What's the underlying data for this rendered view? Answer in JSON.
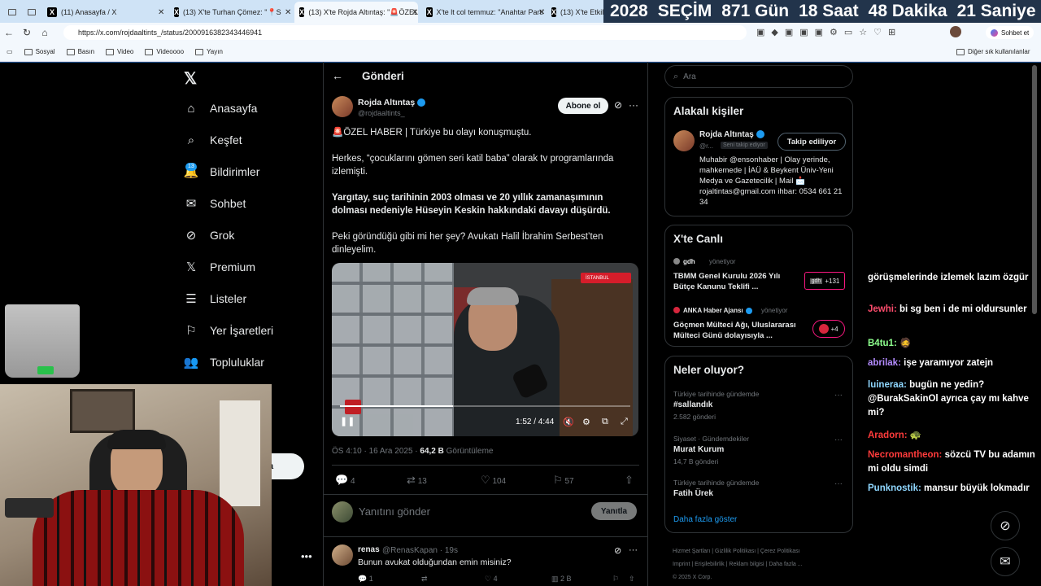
{
  "tabs": [
    {
      "label": "(11) Anasayfa / X"
    },
    {
      "label": "(13) X'te Turhan Çömez: \"📍Sağlı"
    },
    {
      "label": "(13) X'te Rojda Altıntaş: \"🚨ÖZEL"
    },
    {
      "label": "X'te lt col temmuz: \"Anahtar Parti"
    },
    {
      "label": "(13) X'te Etkili"
    }
  ],
  "countdown": {
    "year": "2028",
    "label": "SEÇİM",
    "days": "871 Gün",
    "hours": "18 Saat",
    "minutes": "48 Dakika",
    "seconds": "21 Saniye"
  },
  "address": {
    "url": "https://x.com/rojdaaltints_/status/2000916382343446941",
    "chat_button": "Sohbet et"
  },
  "bookmarks": {
    "items": [
      "Sosyal",
      "Basın",
      "Video",
      "Videoooo",
      "Yayın"
    ],
    "other": "Diğer sık kullanılanlar"
  },
  "nav": {
    "items": [
      "Anasayfa",
      "Keşfet",
      "Bildirimler",
      "Sohbet",
      "Grok",
      "Premium",
      "Listeler",
      "Yer İşaretleri",
      "Topluluklar"
    ],
    "badge": "13",
    "post_partial": "a"
  },
  "header": {
    "title": "Gönderi"
  },
  "post": {
    "name": "Rojda Altıntaş",
    "handle": "@rojdaaltints_",
    "subscribe": "Abone ol",
    "p1": "🚨ÖZEL HABER | Türkiye bu olayı konuşmuştu.",
    "p2": "Herkes, “çocuklarını gömen seri katil baba” olarak tv programlarında izlemişti.",
    "p3": "Yargıtay, suç tarihinin 2003 olması ve 20 yıllık zamanaşımının dolması nedeniyle Hüseyin Keskin hakkındaki davayı düşürdü.",
    "p4": "Peki göründüğü gibi mi her şey? Avukatı Halil İbrahim Serbest’ten dinleyelim.",
    "video": {
      "time": "1:52 / 4:44",
      "tag": "İSTANBUL",
      "progress": 0.39
    },
    "meta_time": "ÖS 4:10 · 16 Ara 2025 · ",
    "views": "64,2 B",
    "views_label": " Görüntüleme",
    "stats": {
      "replies": "4",
      "reposts": "13",
      "likes": "104",
      "bookmarks": "57"
    },
    "reply_placeholder": "Yanıtını gönder",
    "reply_button": "Yanıtla"
  },
  "reply": {
    "name": "renas",
    "handle": "@RenasKapan · 19s",
    "text": "Bunun avukat olduğundan emin misiniz?",
    "stats": {
      "replies": "1",
      "likes": "4",
      "views": "2 B"
    }
  },
  "search": {
    "placeholder": "Ara"
  },
  "related": {
    "title": "Alakalı kişiler",
    "name": "Rojda Altıntaş",
    "handle": "@r...",
    "tag": "Seni takip ediyor",
    "follow": "Takip ediliyor",
    "bio": "Muhabir @ensonhaber | Olay yerinde, mahkemede | İAÜ & Beykent Üniv-Yeni Medya ve Gazetecilik | Mail 📩 rojaltintas@gmail.com ihbar: 0534 661 21 34"
  },
  "live": {
    "title": "X'te Canlı",
    "items": [
      {
        "host": "gdh",
        "role": "yönetiyor",
        "text": "TBMM Genel Kurulu 2026 Yılı Bütçe Kanunu Teklifi ...",
        "count": "+131"
      },
      {
        "host": "ANKA Haber Ajansı",
        "role": "yönetiyor",
        "text": "Göçmen Mülteci Ağı, Uluslararası Mülteci Günü dolayısıyla ...",
        "count": "+4"
      }
    ]
  },
  "trends": {
    "title": "Neler oluyor?",
    "items": [
      {
        "context": "Türkiye tarihinde gündemde",
        "name": "#sallandık",
        "count": "2.582 gönderi"
      },
      {
        "context": "Siyaset · Gündemdekiler",
        "name": "Murat Kurum",
        "count": "14,7 B gönderi"
      },
      {
        "context": "Türkiye tarihinde gündemde",
        "name": "Fatih Ürek",
        "count": ""
      }
    ],
    "more": "Daha fazla göster"
  },
  "footer": {
    "links": [
      "Hizmet Şartları",
      "Gizlilik Politikası",
      "Çerez Politikası",
      "Imprint",
      "Erişilebilirlik",
      "Reklam bilgisi",
      "Daha fazla ..."
    ],
    "copyright": "© 2025 X Corp."
  },
  "chat": [
    {
      "user": "",
      "color": "#ffffff",
      "msg": "görüşmelerinde izlemek lazım özgür"
    },
    {
      "user": "Jewhi:",
      "color": "#ff4d6d",
      "msg": "bi sg ben i de mi oldursunler"
    },
    {
      "user": "B4tu1:",
      "color": "#8dff8d",
      "msg": "🧔"
    },
    {
      "user": "abrilak:",
      "color": "#b48cff",
      "msg": "işe yaramıyor zatejn"
    },
    {
      "user": "luineraa:",
      "color": "#8fd7ff",
      "msg": "bugün ne yedin? @BurakSakinOl ayrıca çay mı kahve mi?"
    },
    {
      "user": "Aradorn:",
      "color": "#ff3b3b",
      "msg": "🐢"
    },
    {
      "user": "Necromantheon:",
      "color": "#ff3b3b",
      "msg": "sözcü TV bu adamın mi oldu simdi"
    },
    {
      "user": "Punknostik:",
      "color": "#8fd7ff",
      "msg": "mansur büyük lokmadır"
    }
  ]
}
